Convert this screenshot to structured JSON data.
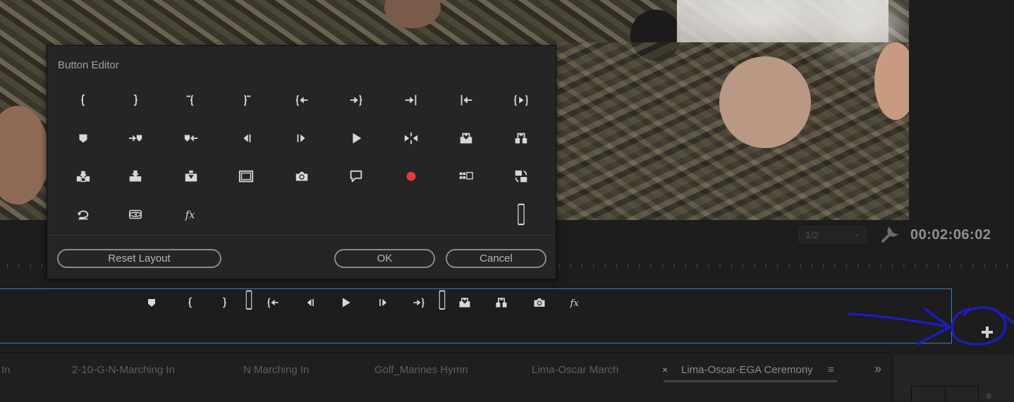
{
  "program_monitor": {
    "resolution": "1/2",
    "timecode": "00:02:06:02"
  },
  "dialog": {
    "title": "Button Editor",
    "buttons": {
      "reset_layout": "Reset Layout",
      "ok": "OK",
      "cancel": "Cancel"
    },
    "icons": [
      "mark-in-icon",
      "mark-out-icon",
      "clear-in-icon",
      "clear-out-icon",
      "go-to-in-icon",
      "go-to-out-icon",
      "go-to-next-edit-icon",
      "go-to-previous-edit-icon",
      "play-in-to-out-icon",
      "add-marker-icon",
      "go-to-previous-marker-icon",
      "go-to-next-marker-icon",
      "step-back-icon",
      "step-forward-icon",
      "play-stop-icon",
      "trim-monitor-icon",
      "lift-icon",
      "extract-icon",
      "insert-icon",
      "overwrite-icon",
      "replace-icon",
      "safe-margins-icon",
      "export-frame-icon",
      "comment-icon",
      "record-icon",
      "multi-camera-icon",
      "toggle-proxies-icon",
      "loop-icon",
      "vr-video-icon",
      "effects-icon",
      "spacer-icon"
    ]
  },
  "button_bar": {
    "icons": [
      "add-marker-icon",
      "mark-in-icon",
      "mark-out-icon",
      "spacer-icon",
      "go-to-in-icon",
      "step-back-icon",
      "play-stop-icon",
      "step-forward-icon",
      "go-to-out-icon",
      "spacer-icon",
      "lift-icon",
      "extract-icon",
      "export-frame-icon",
      "effects-icon"
    ]
  },
  "tabs": [
    {
      "label": "In"
    },
    {
      "label": "2-10-G-N-Marching In"
    },
    {
      "label": "N Marching In"
    },
    {
      "label": "Golf_Marines Hymn"
    },
    {
      "label": "Lima-Oscar March"
    },
    {
      "label": "Lima-Oscar-EGA Ceremony",
      "active": true
    }
  ],
  "tab_controls": {
    "close": "×",
    "menu": "≡",
    "overflow": "»"
  },
  "audio_meter": {
    "label": "0"
  },
  "colors": {
    "panel_bg": "#1d1d1d",
    "dialog_bg": "#252525",
    "selection_border": "#3a7fc1",
    "record_red": "#e23b3b",
    "annotation_blue": "#1b1bd8"
  }
}
